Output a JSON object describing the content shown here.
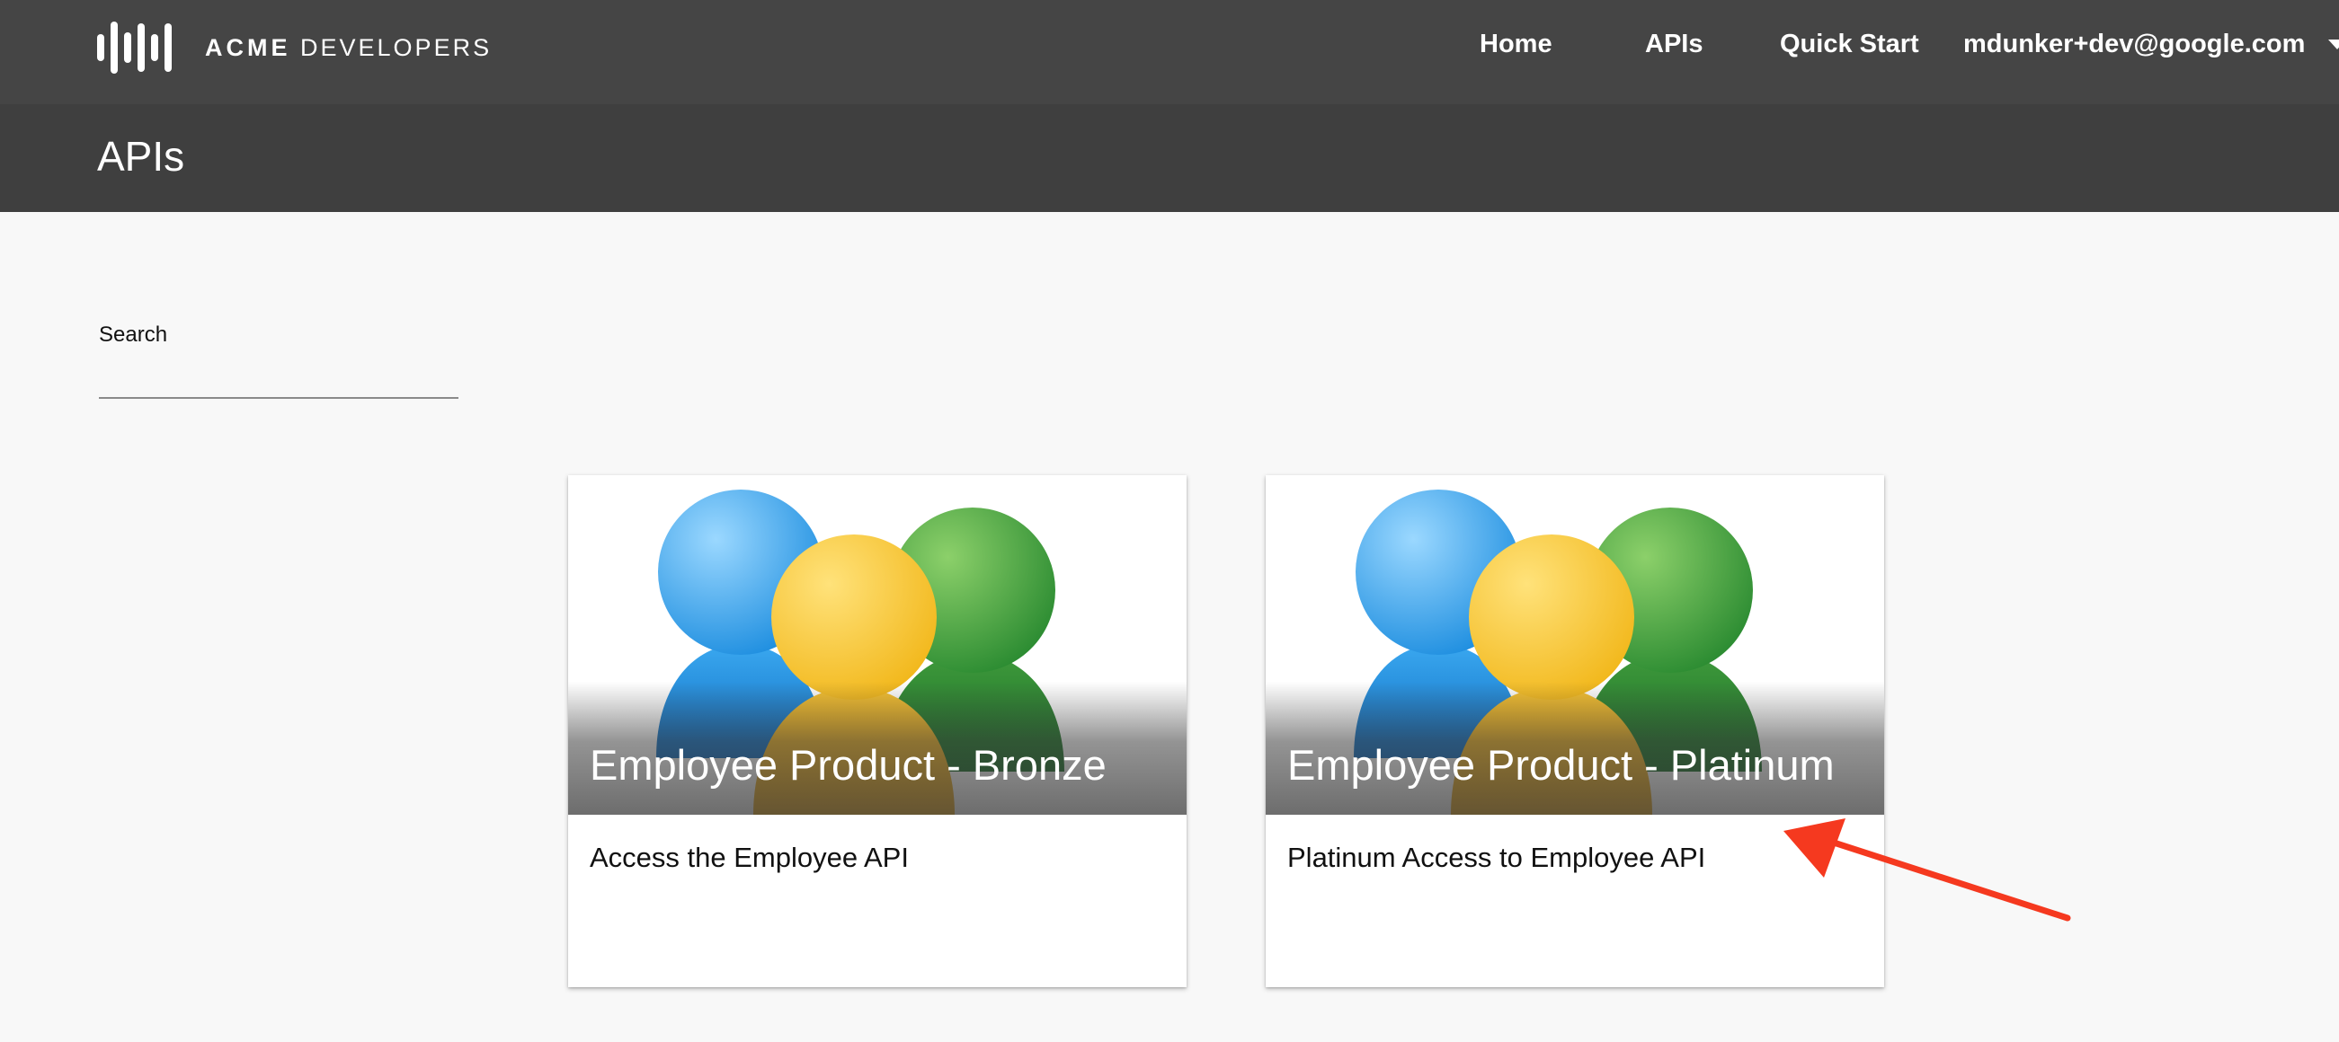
{
  "header": {
    "brand_bold": "ACME",
    "brand_rest": "DEVELOPERS",
    "nav": {
      "home": "Home",
      "apis": "APIs",
      "quick_start": "Quick Start"
    },
    "user_email": "mdunker+dev@google.com"
  },
  "page": {
    "title": "APIs"
  },
  "search": {
    "label": "Search",
    "value": "",
    "placeholder": ""
  },
  "cards": [
    {
      "title": "Employee Product - Bronze",
      "description": "Access the Employee API",
      "image_icon": "employee-group-icon"
    },
    {
      "title": "Employee Product - Platinum",
      "description": "Platinum Access to Employee API",
      "image_icon": "employee-group-icon"
    }
  ],
  "colors": {
    "topbar": "#454545",
    "page_header": "#3f3f3f",
    "background": "#f8f8f8",
    "annotation_arrow": "#f5391f"
  }
}
